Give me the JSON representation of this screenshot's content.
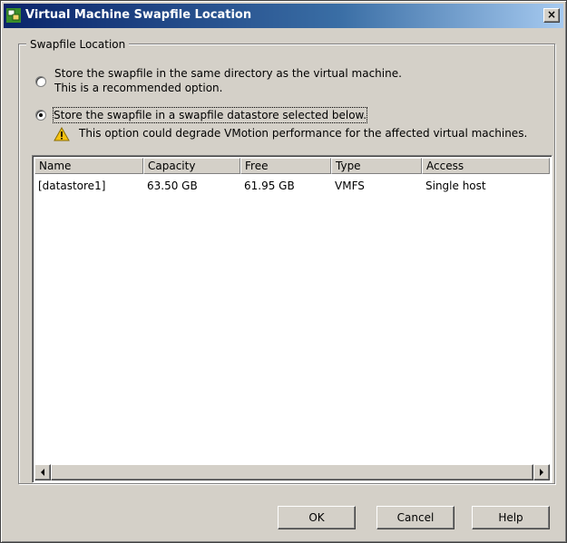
{
  "window": {
    "title": "Virtual Machine Swapfile Location",
    "close_label": "×"
  },
  "group": {
    "legend": "Swapfile Location"
  },
  "options": [
    {
      "label_line1": "Store the swapfile in the same directory as the virtual machine.",
      "label_line2": "This is a recommended option.",
      "checked": false
    },
    {
      "label": "Store the swapfile in a swapfile datastore selected below.",
      "warning": "This option could degrade VMotion performance for the affected virtual machines.",
      "checked": true
    }
  ],
  "table": {
    "columns": [
      "Name",
      "Capacity",
      "Free",
      "Type",
      "Access"
    ],
    "rows": [
      [
        "[datastore1]",
        "63.50 GB",
        "61.95 GB",
        "VMFS",
        "Single host"
      ]
    ]
  },
  "buttons": {
    "ok": "OK",
    "cancel": "Cancel",
    "help": "Help"
  },
  "icons": {
    "app": "vm-swapfile-icon",
    "warning": "warning-icon",
    "close": "close-icon",
    "scroll_left": "arrow-left-icon",
    "scroll_right": "arrow-right-icon"
  },
  "colors": {
    "titlebar_start": "#0a246a",
    "titlebar_end": "#a6caf0",
    "face": "#d4d0c8",
    "warning": "#f5c211"
  }
}
